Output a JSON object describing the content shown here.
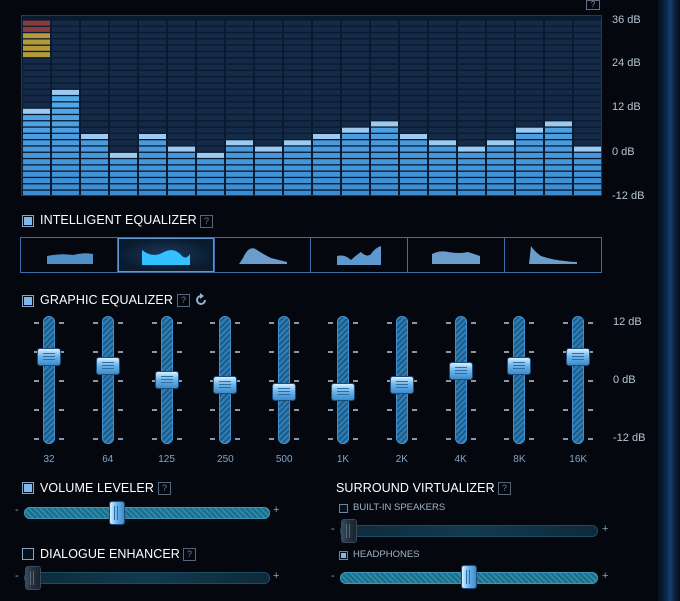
{
  "analyzer": {
    "db_labels": [
      "36 dB",
      "24 dB",
      "12 dB",
      "0 dB",
      "-12 dB"
    ],
    "help": "?"
  },
  "intelligent_eq": {
    "title": "INTELLIGENT EQUALIZER",
    "checked": true,
    "help": "?",
    "active_preset": 1
  },
  "graphic_eq": {
    "title": "GRAPHIC EQUALIZER",
    "checked": true,
    "help": "?",
    "db_labels": [
      "12 dB",
      "0 dB",
      "-12 dB"
    ],
    "bands": [
      {
        "freq": "32",
        "db": 5
      },
      {
        "freq": "64",
        "db": 3
      },
      {
        "freq": "125",
        "db": 0
      },
      {
        "freq": "250",
        "db": -1
      },
      {
        "freq": "500",
        "db": -2.5
      },
      {
        "freq": "1K",
        "db": -2.5
      },
      {
        "freq": "2K",
        "db": -1
      },
      {
        "freq": "4K",
        "db": 2
      },
      {
        "freq": "8K",
        "db": 3
      },
      {
        "freq": "16K",
        "db": 5
      }
    ]
  },
  "volume_leveler": {
    "title": "VOLUME LEVELER",
    "checked": true,
    "help": "?",
    "value": 0.37,
    "minus": "-",
    "plus": "+"
  },
  "dialogue_enhancer": {
    "title": "DIALOGUE ENHANCER",
    "checked": false,
    "help": "?",
    "value": 0.0,
    "minus": "-",
    "plus": "+"
  },
  "surround": {
    "title": "SURROUND VIRTUALIZER",
    "help": "?",
    "speakers": {
      "label": "BUILT-IN SPEAKERS",
      "checked": false,
      "value": 0.0,
      "minus": "-",
      "plus": "+"
    },
    "headphones": {
      "label": "HEADPHONES",
      "checked": true,
      "value": 0.5,
      "minus": "-",
      "plus": "+"
    }
  }
}
